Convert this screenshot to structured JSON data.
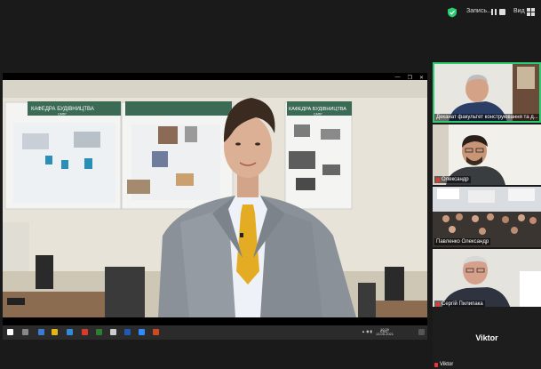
{
  "topbar": {
    "recording_label": "Запись...",
    "view_label": "Вид"
  },
  "share": {
    "banner_left": "КАФЕДРА БУДІВНИЦТВА",
    "banner_left_sub": "САПР",
    "banner_right": "КАФЕДРА БУДІВНИЦТВА",
    "banner_right_sub": "САПР",
    "taskbar": {
      "lang": "ENG",
      "time": "10:29",
      "date": "13.05.2021"
    }
  },
  "participants": [
    {
      "name": "Деканат факультет конструювання та д...",
      "muted": false,
      "active": true
    },
    {
      "name": "Олександр",
      "muted": true,
      "active": false
    },
    {
      "name": "Павленко Олександр",
      "muted": false,
      "active": false
    },
    {
      "name": "Сергій Пилипака",
      "muted": true,
      "active": false
    }
  ],
  "name_tile": {
    "display": "Viktor",
    "label": "Viktor",
    "muted": true
  },
  "colors": {
    "background": "#1a1a1a",
    "active_border": "#2ecc71",
    "shield": "#2ecc71",
    "mute_red": "#e33333"
  }
}
